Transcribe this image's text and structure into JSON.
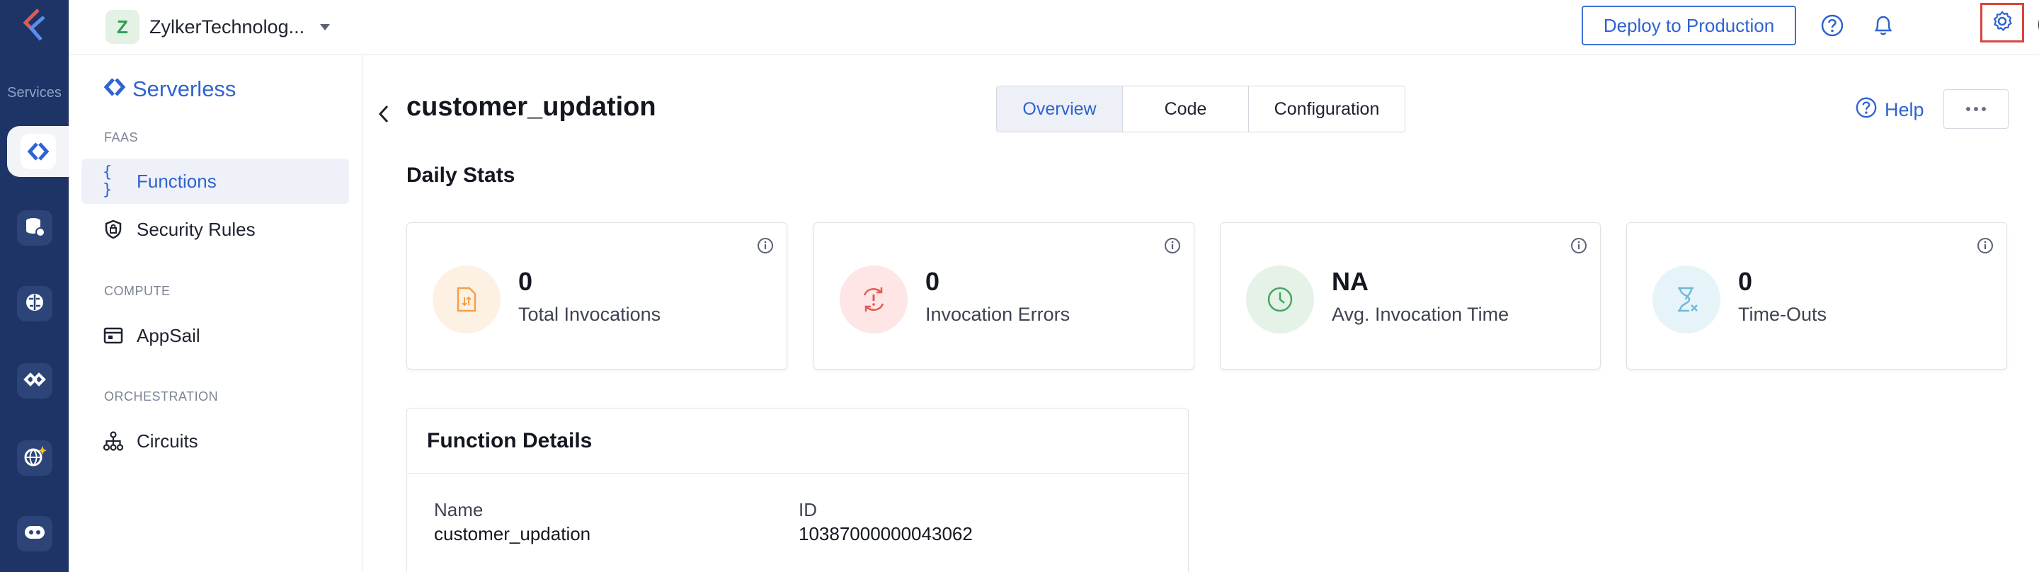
{
  "rail": {
    "services_label": "Services",
    "items": [
      "serverless-icon",
      "database-icon",
      "brain-icon",
      "link-icon",
      "globe-sparkle-icon",
      "bot-icon"
    ]
  },
  "topbar": {
    "org_initial": "Z",
    "org_name": "ZylkerTechnolog...",
    "deploy_label": "Deploy to Production"
  },
  "sidebar": {
    "brand": "Serverless",
    "sections": {
      "faas": "FAAS",
      "compute": "COMPUTE",
      "orchestration": "ORCHESTRATION"
    },
    "items": {
      "functions": "Functions",
      "security_rules": "Security Rules",
      "appsail": "AppSail",
      "circuits": "Circuits"
    }
  },
  "main": {
    "title": "customer_updation",
    "tabs": [
      "Overview",
      "Code",
      "Configuration"
    ],
    "active_tab": "Overview",
    "help_label": "Help",
    "daily_stats_heading": "Daily Stats",
    "stats": [
      {
        "value": "0",
        "label": "Total Invocations",
        "color": "#f5a04a"
      },
      {
        "value": "0",
        "label": "Invocation Errors",
        "color": "#e45a53"
      },
      {
        "value": "NA",
        "label": "Avg. Invocation Time",
        "color": "#4aa564"
      },
      {
        "value": "0",
        "label": "Time-Outs",
        "color": "#6fb9da"
      }
    ],
    "details": {
      "heading": "Function Details",
      "name_label": "Name",
      "name_value": "customer_updation",
      "id_label": "ID",
      "id_value": "10387000000043062"
    }
  },
  "colors": {
    "accent": "#2e63d1",
    "rail": "#1f3466",
    "highlight_box": "#d9453e"
  }
}
